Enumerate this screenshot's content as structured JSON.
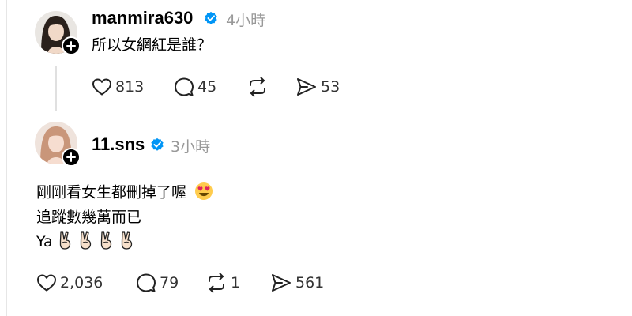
{
  "posts": [
    {
      "username": "manmira630",
      "time": "4小時",
      "text_lines": [
        "所以女網紅是誰？"
      ],
      "likes": "813",
      "comments": "45",
      "reposts": "",
      "shares": "53"
    },
    {
      "username": "11.sns",
      "time": "3小時",
      "text_lines": [
        "剛剛看女生都刪掉了喔",
        "追蹤數幾萬而已",
        "Ya"
      ],
      "likes": "2,036",
      "comments": "79",
      "reposts": "1",
      "shares": "561"
    }
  ],
  "icons": {
    "verified": "verified-badge-icon",
    "follow": "plus-icon",
    "like": "heart-icon",
    "comment": "comment-icon",
    "repost": "repost-icon",
    "share": "send-icon",
    "emoji_heart_eyes": "heart-eyes-emoji",
    "emoji_victory": "victory-hand-emoji"
  },
  "colors": {
    "verified": "#0095f6",
    "time": "#999999",
    "text": "#000000"
  }
}
